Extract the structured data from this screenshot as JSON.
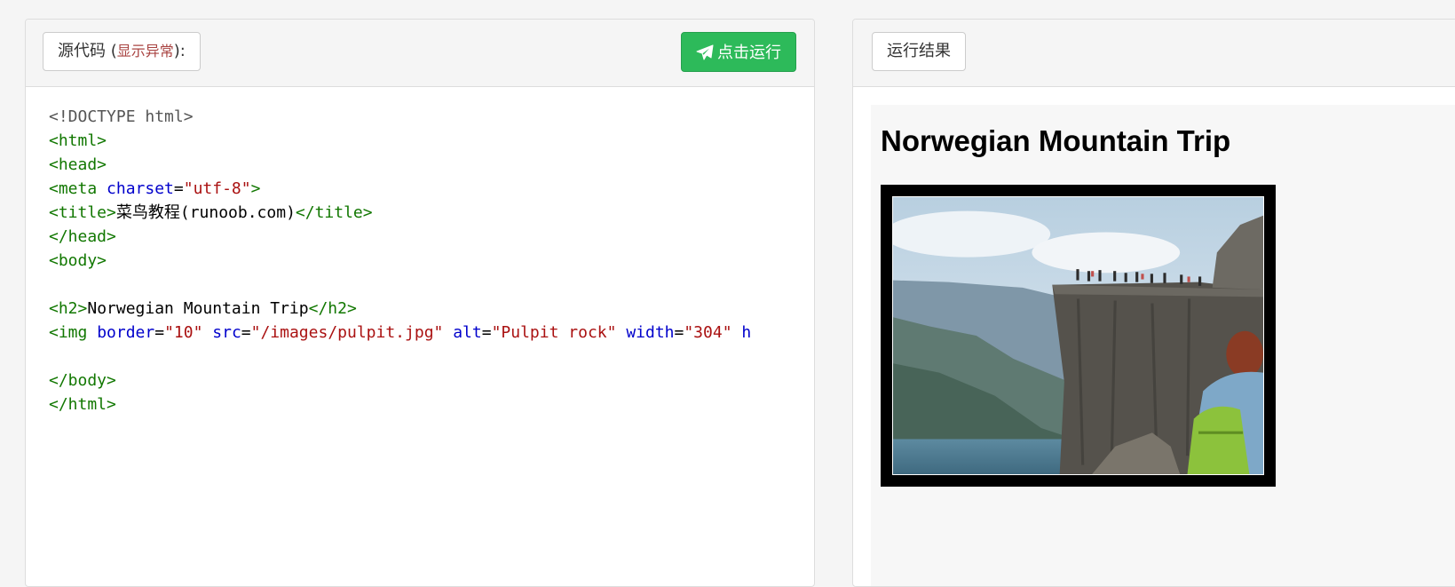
{
  "source_panel": {
    "title": "源代码",
    "title_open": " (",
    "error_link": "显示异常",
    "title_close": "):"
  },
  "run_button": {
    "label": "点击运行",
    "icon": "paper-plane-icon"
  },
  "code_lines": [
    [
      {
        "t": "doc",
        "v": "<!DOCTYPE html>"
      }
    ],
    [
      {
        "t": "tag",
        "v": "<html>"
      }
    ],
    [
      {
        "t": "tag",
        "v": "<head>"
      }
    ],
    [
      {
        "t": "tag",
        "v": "<meta "
      },
      {
        "t": "attr",
        "v": "charset"
      },
      {
        "t": "text",
        "v": "="
      },
      {
        "t": "str",
        "v": "\"utf-8\""
      },
      {
        "t": "tag",
        "v": ">"
      }
    ],
    [
      {
        "t": "tag",
        "v": "<title>"
      },
      {
        "t": "text",
        "v": "菜鸟教程(runoob.com)"
      },
      {
        "t": "tag",
        "v": "</title>"
      }
    ],
    [
      {
        "t": "tag",
        "v": "</head>"
      }
    ],
    [
      {
        "t": "tag",
        "v": "<body>"
      }
    ],
    [],
    [
      {
        "t": "tag",
        "v": "<h2>"
      },
      {
        "t": "text",
        "v": "Norwegian Mountain Trip"
      },
      {
        "t": "tag",
        "v": "</h2>"
      }
    ],
    [
      {
        "t": "tag",
        "v": "<img "
      },
      {
        "t": "attr",
        "v": "border"
      },
      {
        "t": "text",
        "v": "="
      },
      {
        "t": "str",
        "v": "\"10\""
      },
      {
        "t": "text",
        "v": " "
      },
      {
        "t": "attr",
        "v": "src"
      },
      {
        "t": "text",
        "v": "="
      },
      {
        "t": "str",
        "v": "\"/images/pulpit.jpg\""
      },
      {
        "t": "text",
        "v": " "
      },
      {
        "t": "attr",
        "v": "alt"
      },
      {
        "t": "text",
        "v": "="
      },
      {
        "t": "str",
        "v": "\"Pulpit rock\""
      },
      {
        "t": "text",
        "v": " "
      },
      {
        "t": "attr",
        "v": "width"
      },
      {
        "t": "text",
        "v": "="
      },
      {
        "t": "str",
        "v": "\"304\""
      },
      {
        "t": "text",
        "v": " "
      },
      {
        "t": "attr",
        "v": "h"
      }
    ],
    [],
    [
      {
        "t": "tag",
        "v": "</body>"
      }
    ],
    [
      {
        "t": "tag",
        "v": "</html>"
      }
    ]
  ],
  "result_panel": {
    "title": "运行结果",
    "heading": "Norwegian Mountain Trip",
    "image_icon": "pulpit-rock-photo"
  },
  "colors": {
    "run_button": "#2dba5a",
    "tag": "#117700",
    "attr": "#0000cc",
    "string": "#aa1111",
    "error": "#a94442"
  }
}
